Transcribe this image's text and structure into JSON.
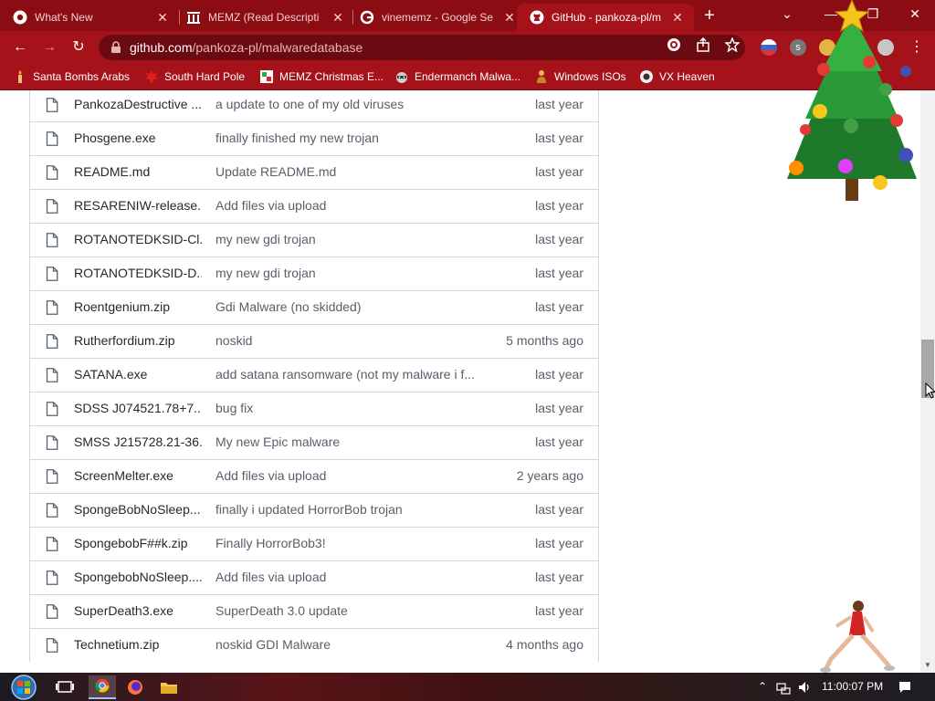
{
  "browser": {
    "tabs": [
      {
        "title": "What's New",
        "icon": "chrome-icon"
      },
      {
        "title": "MEMZ (Read Descripti",
        "icon": "archive-icon"
      },
      {
        "title": "vinememz - Google Se",
        "icon": "google-icon"
      },
      {
        "title": "GitHub - pankoza-pl/m",
        "icon": "github-icon",
        "active": true
      }
    ],
    "url": {
      "host": "github.com",
      "path": "/pankoza-pl/malwaredatabase"
    },
    "bookmarks": [
      {
        "label": "Santa Bombs Arabs",
        "icon": "candle-icon"
      },
      {
        "label": "South Hard Pole",
        "icon": "maple-leaf-icon"
      },
      {
        "label": "MEMZ Christmas E...",
        "icon": "memz-icon"
      },
      {
        "label": "Endermanch Malwa...",
        "icon": "raccoon-icon"
      },
      {
        "label": "Windows ISOs",
        "icon": "person-icon"
      },
      {
        "label": "VX Heaven",
        "icon": "vx-icon"
      }
    ],
    "theme_color": "#a5121a"
  },
  "files": [
    {
      "name": "PankozaDestructive ...",
      "message": "a update to one of my old viruses",
      "date": "last year"
    },
    {
      "name": "Phosgene.exe",
      "message": "finally finished my new trojan",
      "date": "last year"
    },
    {
      "name": "README.md",
      "message": "Update README.md",
      "date": "last year"
    },
    {
      "name": "RESARENIW-release....",
      "message": "Add files via upload",
      "date": "last year"
    },
    {
      "name": "ROTANOTEDKSID-Cl...",
      "message": "my new gdi trojan",
      "date": "last year"
    },
    {
      "name": "ROTANOTEDKSID-D...",
      "message": "my new gdi trojan",
      "date": "last year"
    },
    {
      "name": "Roentgenium.zip",
      "message": "Gdi Malware (no skidded)",
      "date": "last year"
    },
    {
      "name": "Rutherfordium.zip",
      "message": "noskid",
      "date": "5 months ago"
    },
    {
      "name": "SATANA.exe",
      "message": "add satana ransomware (not my malware i f...",
      "date": "last year"
    },
    {
      "name": "SDSS J074521.78+7...",
      "message": "bug fix",
      "date": "last year"
    },
    {
      "name": "SMSS J215728.21-36...",
      "message": "My new Epic malware",
      "date": "last year"
    },
    {
      "name": "ScreenMelter.exe",
      "message": "Add files via upload",
      "date": "2 years ago"
    },
    {
      "name": "SpongeBobNoSleep...",
      "message": "finally i updated HorrorBob trojan",
      "date": "last year"
    },
    {
      "name": "SpongebobF##k.zip",
      "message": "Finally HorrorBob3!",
      "date": "last year"
    },
    {
      "name": "SpongebobNoSleep....",
      "message": "Add files via upload",
      "date": "last year"
    },
    {
      "name": "SuperDeath3.exe",
      "message": "SuperDeath 3.0 update",
      "date": "last year"
    },
    {
      "name": "Technetium.zip",
      "message": "noskid GDI Malware",
      "date": "4 months ago"
    }
  ],
  "taskbar": {
    "apps": [
      "start-orb-icon",
      "task-view-icon",
      "chrome-icon",
      "firefox-icon",
      "file-explorer-icon"
    ],
    "time": "11:00:07 PM"
  }
}
